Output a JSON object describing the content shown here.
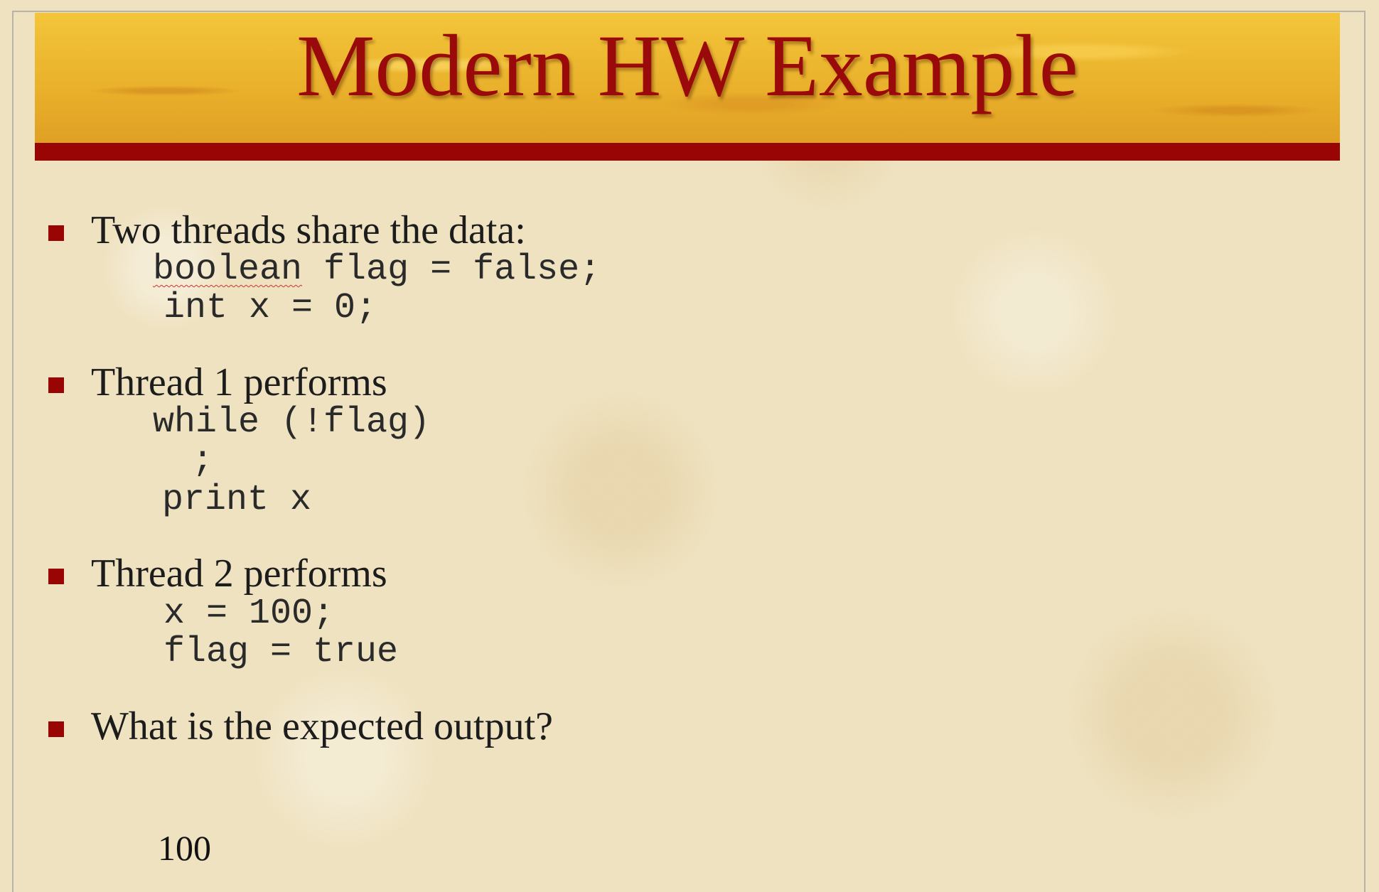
{
  "slide": {
    "title": "Modern HW Example",
    "bullets": [
      {
        "text": "Two threads share the data:",
        "code": [
          "boolean",
          " flag = false;",
          "int x = 0;"
        ]
      },
      {
        "text": "Thread 1 performs",
        "code": [
          "while (!flag)",
          ";",
          "print x"
        ]
      },
      {
        "text": "Thread 2 performs",
        "code": [
          "x = 100;",
          "flag = true"
        ]
      },
      {
        "text": "What is the expected output?",
        "code": []
      }
    ],
    "page_number": "100"
  },
  "colors": {
    "title_text": "#9a0a0a",
    "accent_rule": "#990505",
    "bullet": "#990505",
    "banner": "#eab22c",
    "background": "#efe2c0"
  }
}
